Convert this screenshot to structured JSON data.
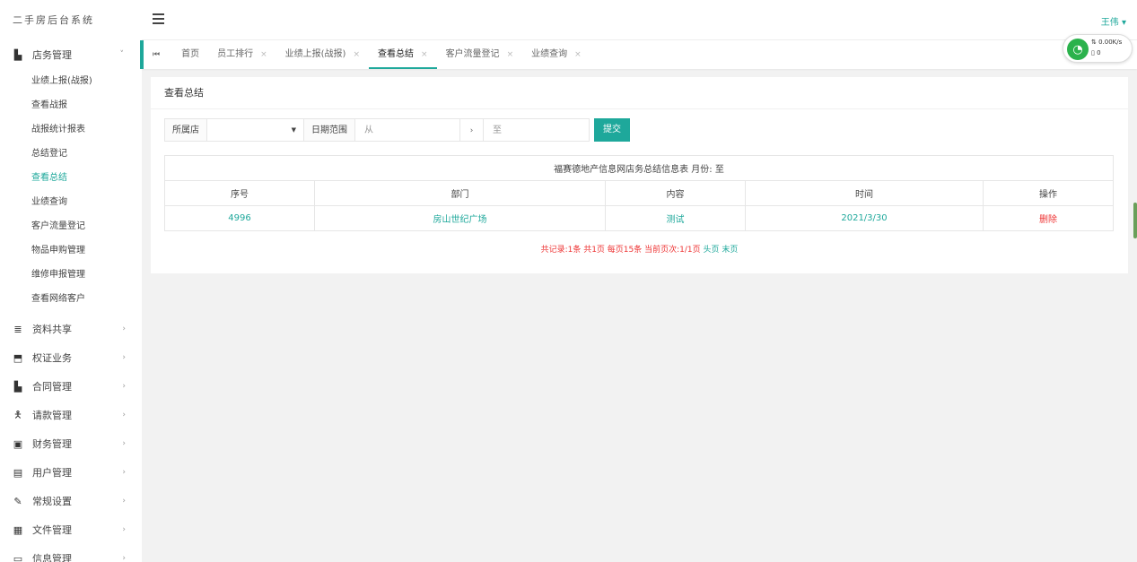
{
  "app": {
    "title": "二手房后台系统",
    "user": "王伟 ▾"
  },
  "sidebar": {
    "open_group": {
      "label": "店务管理",
      "arrow": "˅"
    },
    "sub_items": [
      {
        "label": "业绩上报(战报)"
      },
      {
        "label": "查看战报"
      },
      {
        "label": "战报统计报表"
      },
      {
        "label": "总结登记"
      },
      {
        "label": "查看总结"
      },
      {
        "label": "业绩查询"
      },
      {
        "label": "客户流量登记"
      },
      {
        "label": "物品申购管理"
      },
      {
        "label": "维修申报管理"
      },
      {
        "label": "查看网络客户"
      }
    ],
    "groups": [
      {
        "label": "资料共享",
        "icon": "≣",
        "arrow": "›"
      },
      {
        "label": "权证业务",
        "icon": "⬒",
        "arrow": "›"
      },
      {
        "label": "合同管理",
        "icon": "▙",
        "arrow": "›"
      },
      {
        "label": "请款管理",
        "icon": "🯅",
        "arrow": "›"
      },
      {
        "label": "财务管理",
        "icon": "▣",
        "arrow": "›"
      },
      {
        "label": "用户管理",
        "icon": "▤",
        "arrow": "›"
      },
      {
        "label": "常规设置",
        "icon": "✎",
        "arrow": "›"
      },
      {
        "label": "文件管理",
        "icon": "▦",
        "arrow": "›"
      },
      {
        "label": "信息管理",
        "icon": "▭",
        "arrow": "›"
      }
    ]
  },
  "tabs": {
    "prev": "⏮",
    "close": "×",
    "items": [
      {
        "label": "首页"
      },
      {
        "label": "员工排行"
      },
      {
        "label": "业绩上报(战报)"
      },
      {
        "label": "查看总结"
      },
      {
        "label": "客户流量登记"
      },
      {
        "label": "业绩查询"
      }
    ]
  },
  "network": {
    "speed": "⇅ 0.00K/s",
    "count": "▯ 0"
  },
  "panel": {
    "title": "查看总结"
  },
  "filter": {
    "store_label": "所属店",
    "store_value": "",
    "date_label": "日期范围",
    "from_placeholder": "从",
    "to_placeholder": "至",
    "arrow": "›",
    "submit": "提交"
  },
  "table": {
    "caption": "福赛德地产信息网店务总结信息表  月份: 至",
    "headers": [
      "序号",
      "部门",
      "内容",
      "时间",
      "操作"
    ],
    "rows": [
      {
        "id": "4996",
        "dept": "房山世纪广场",
        "content": "测试",
        "time": "2021/3/30",
        "action": "删除"
      }
    ]
  },
  "pager": {
    "summary": "共记录:1条 共1页 每页15条 当前页次:1/1页",
    "first": "头页",
    "last": "末页"
  }
}
